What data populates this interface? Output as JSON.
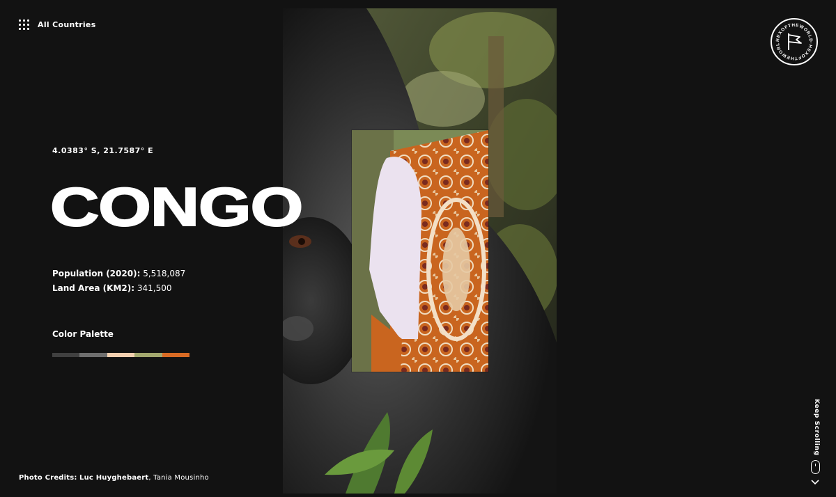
{
  "nav": {
    "all_countries_label": "All Countries"
  },
  "badge": {
    "ring_text": "HEXOFTHEWORLD·HEXOFTHEWORLD·",
    "icon": "flag-icon"
  },
  "country": {
    "coordinates": "4.0383° S, 21.7587° E",
    "name": "CONGO",
    "population_label": "Population (2020):",
    "population_value": "5,518,087",
    "land_area_label": "Land Area (KM2):",
    "land_area_value": "341,500"
  },
  "palette": {
    "label": "Color Palette",
    "colors": [
      "#404040",
      "#6e6e6e",
      "#f2cfaf",
      "#a3a86e",
      "#d86a24"
    ]
  },
  "credits": {
    "label": "Photo Credits:",
    "photographer_1": "Luc Huyghebaert",
    "separator": ",",
    "photographer_2": "Tania Mousinho"
  },
  "scroll": {
    "label": "Keep Scrolling"
  },
  "images": {
    "main_photo": "gorilla-photo",
    "inset_photo": "african-print-shirt-photo"
  }
}
